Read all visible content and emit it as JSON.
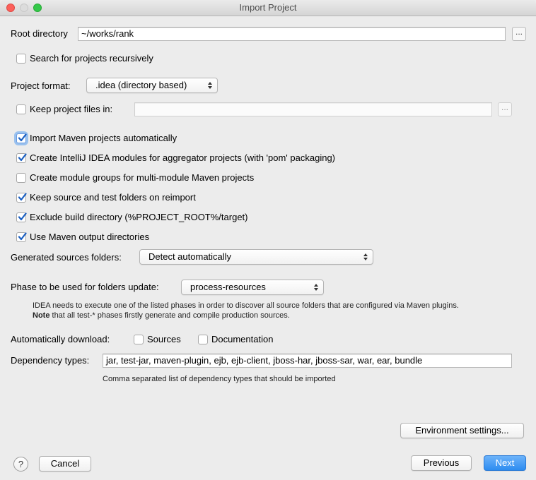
{
  "window": {
    "title": "Import Project"
  },
  "root": {
    "label": "Root directory",
    "value": "~/works/rank",
    "browse": "..."
  },
  "search_recursive": {
    "label": "Search for projects recursively",
    "checked": false
  },
  "project_format": {
    "label": "Project format:",
    "value": ".idea (directory based)"
  },
  "keep_files": {
    "label": "Keep project files in:",
    "checked": false,
    "value": "",
    "browse": "..."
  },
  "options": [
    {
      "label": "Import Maven projects automatically",
      "checked": true
    },
    {
      "label": "Create IntelliJ IDEA modules for aggregator projects (with 'pom' packaging)",
      "checked": true
    },
    {
      "label": "Create module groups for multi-module Maven projects",
      "checked": false
    },
    {
      "label": "Keep source and test folders on reimport",
      "checked": true
    },
    {
      "label": "Exclude build directory (%PROJECT_ROOT%/target)",
      "checked": true
    },
    {
      "label": "Use Maven output directories",
      "checked": true
    }
  ],
  "generated_sources": {
    "label": "Generated sources folders:",
    "value": "Detect automatically"
  },
  "phase": {
    "label": "Phase to be used for folders update:",
    "value": "process-resources",
    "hint_line1": "IDEA needs to execute one of the listed phases in order to discover all source folders that are configured via Maven plugins.",
    "hint_note_bold": "Note",
    "hint_line2": " that all test-* phases firstly generate and compile production sources."
  },
  "auto_download": {
    "label": "Automatically download:",
    "sources": {
      "label": "Sources",
      "checked": false
    },
    "documentation": {
      "label": "Documentation",
      "checked": false
    }
  },
  "dependency_types": {
    "label": "Dependency types:",
    "value": "jar, test-jar, maven-plugin, ejb, ejb-client, jboss-har, jboss-sar, war, ear, bundle",
    "hint": "Comma separated list of dependency types that should be imported"
  },
  "buttons": {
    "environment": "Environment settings...",
    "help": "?",
    "cancel": "Cancel",
    "previous": "Previous",
    "next": "Next"
  },
  "colors": {
    "accent": "#2d8cf0",
    "check": "#1a5fc2"
  }
}
